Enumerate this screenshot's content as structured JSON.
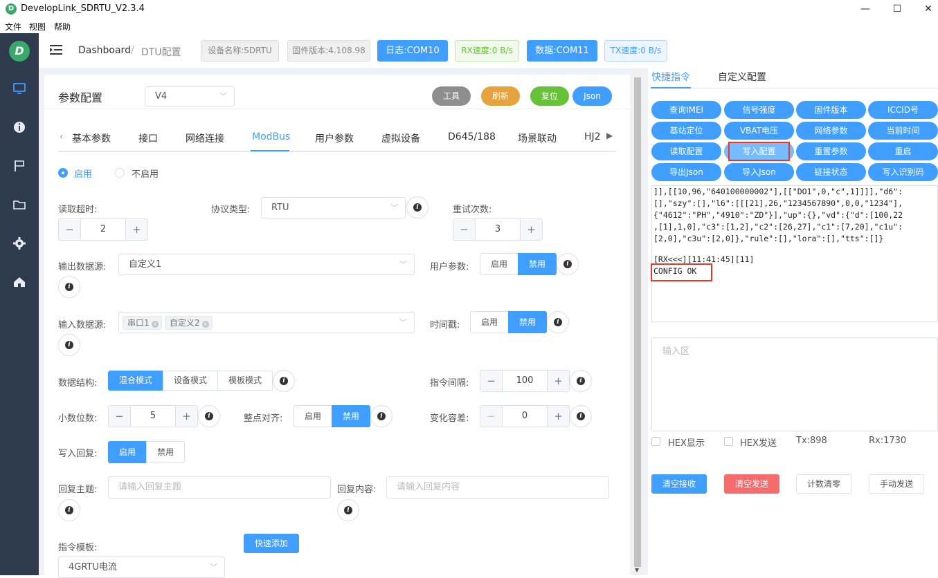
{
  "window": {
    "title": "DevelopLink_SDRTU_V2.3.4",
    "logo_letter": "D"
  },
  "menu": [
    "文件",
    "视图",
    "帮助"
  ],
  "header": {
    "breadcrumb_home": "Dashboard",
    "breadcrumb_sep": "/",
    "breadcrumb_current": "DTU配置",
    "device_name": "设备名称:SDRTU",
    "firmware": "固件版本:4.108.98",
    "log_port": "日志:COM10",
    "rx_speed": "RX速度:0 B/s",
    "data_port": "数据:COM11",
    "tx_speed": "TX速度:0 B/s"
  },
  "params": {
    "title": "参数配置",
    "version_select": "V4",
    "btn_tools": "工具",
    "btn_refresh": "刷新",
    "btn_reset": "复位",
    "btn_json": "Json",
    "colors": {
      "tools": "#8e8e8e",
      "refresh": "#e6a23c",
      "reset": "#67c23a",
      "json": "#409eff"
    }
  },
  "tabs": [
    "基本参数",
    "接口",
    "网络连接",
    "ModBus",
    "用户参数",
    "虚拟设备",
    "D645/188",
    "场景联动",
    "HJ2"
  ],
  "active_tab": "ModBus",
  "form": {
    "enable": "启用",
    "disable": "不启用",
    "read_timeout_label": "读取超时:",
    "read_timeout_value": "2",
    "protocol_label": "协议类型:",
    "protocol_value": "RTU",
    "retry_label": "重试次数:",
    "retry_value": "3",
    "output_source_label": "输出数据源:",
    "output_source_value": "自定义1",
    "user_param_label": "用户参数:",
    "input_source_label": "输入数据源:",
    "input_source_tags": [
      "串口1",
      "自定义2"
    ],
    "timestamp_label": "时间戳:",
    "data_struct_label": "数据结构:",
    "data_struct_options": [
      "混合模式",
      "设备模式",
      "模板模式"
    ],
    "cmd_interval_label": "指令间隔:",
    "cmd_interval_value": "100",
    "decimal_label": "小数位数:",
    "decimal_value": "5",
    "align_label": "整点对齐:",
    "tolerance_label": "变化容差:",
    "tolerance_value": "0",
    "write_reply_label": "写入回复:",
    "on": "启用",
    "off": "禁用",
    "reply_topic_label": "回复主题:",
    "reply_topic_placeholder": "请输入回复主题",
    "reply_content_label": "回复内容:",
    "reply_content_placeholder": "请输入回复内容",
    "template_label": "指令模板:",
    "quick_add": "快速添加",
    "template_value": "4GRTU电流"
  },
  "right": {
    "tab_quick": "快捷指令",
    "tab_custom": "自定义配置",
    "quick_buttons": [
      "查询IMEI",
      "信号强度",
      "固件版本",
      "ICCID号",
      "基站定位",
      "VBAT电压",
      "网络参数",
      "当前时间",
      "读取配置",
      "写入配置",
      "重置参数",
      "重启",
      "导出Json",
      "导入Json",
      "链接状态",
      "写入识别码"
    ],
    "log_lines": [
      "]],[[10,96,\"640100000002\"],[[\"DO1\",0,\"c\",1]]]],\"d6\":",
      "[],\"szy\":[],\"l6\":[[[21],26,\"1234567890\",0,0,\"1234\"],",
      "{\"4612\":\"PH\",\"4910\":\"ZD\"}],\"up\":{},\"vd\":{\"d\":[100,22",
      ",[1],1,0],\"c3\":[1,2],\"c2\":[26,27],\"c1\":[7,20],\"c1u\":",
      "[2,0],\"c3u\":[2,0]},\"rule\":[],\"lora\":[],\"tts\":[]}",
      "",
      "[RX<<<][11:41:45][11]",
      "CONFIG OK"
    ],
    "input_placeholder": "输入区",
    "hex_display": "HEX显示",
    "hex_send": "HEX发送",
    "tx_count": "Tx:898",
    "rx_count": "Rx:1730",
    "btn_clear_recv": "清空接收",
    "btn_clear_send": "清空发送",
    "btn_reset_count": "计数清零",
    "btn_manual_send": "手动发送"
  }
}
